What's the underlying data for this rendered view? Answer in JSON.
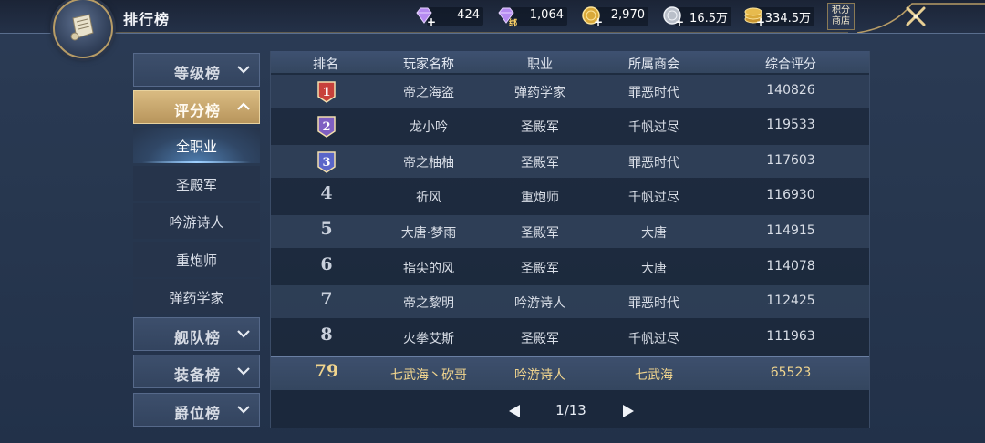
{
  "header": {
    "title": "排行榜",
    "currencies": [
      {
        "icon": "purple-diamond-icon",
        "value": "424"
      },
      {
        "icon": "bound-diamond-icon",
        "badge": "绑",
        "value": "1,064"
      },
      {
        "icon": "gold-coin-icon",
        "value": "2,970"
      },
      {
        "icon": "silver-coin-icon",
        "value": "16.5万"
      },
      {
        "icon": "gold-coin-stack-icon",
        "value": "334.5万"
      }
    ],
    "shop_label_1": "积分",
    "shop_label_2": "商店"
  },
  "sidebar": {
    "categories": [
      {
        "label": "等级榜",
        "expanded": false
      },
      {
        "label": "评分榜",
        "expanded": true
      },
      {
        "label": "舰队榜",
        "expanded": false
      },
      {
        "label": "装备榜",
        "expanded": false
      },
      {
        "label": "爵位榜",
        "expanded": false
      }
    ],
    "subitems": [
      {
        "label": "全职业",
        "active": true
      },
      {
        "label": "圣殿军",
        "active": false
      },
      {
        "label": "吟游诗人",
        "active": false
      },
      {
        "label": "重炮师",
        "active": false
      },
      {
        "label": "弹药学家",
        "active": false
      }
    ]
  },
  "table": {
    "columns": [
      "排名",
      "玩家名称",
      "职业",
      "所属商会",
      "综合评分"
    ],
    "rows": [
      {
        "rank": "1",
        "name": "帝之海盗",
        "class": "弹药学家",
        "guild": "罪恶时代",
        "score": "140826"
      },
      {
        "rank": "2",
        "name": "龙小吟",
        "class": "圣殿军",
        "guild": "千帆过尽",
        "score": "119533"
      },
      {
        "rank": "3",
        "name": "帝之柚柚",
        "class": "圣殿军",
        "guild": "罪恶时代",
        "score": "117603"
      },
      {
        "rank": "4",
        "name": "祈风",
        "class": "重炮师",
        "guild": "千帆过尽",
        "score": "116930"
      },
      {
        "rank": "5",
        "name": "大唐·梦雨",
        "class": "圣殿军",
        "guild": "大唐",
        "score": "114915"
      },
      {
        "rank": "6",
        "name": "指尖的风",
        "class": "圣殿军",
        "guild": "大唐",
        "score": "114078"
      },
      {
        "rank": "7",
        "name": "帝之黎明",
        "class": "吟游诗人",
        "guild": "罪恶时代",
        "score": "112425"
      },
      {
        "rank": "8",
        "name": "火拳艾斯",
        "class": "圣殿军",
        "guild": "千帆过尽",
        "score": "111963"
      }
    ],
    "self_row": {
      "rank": "79",
      "name": "七武海丶砍哥",
      "class": "吟游诗人",
      "guild": "七武海",
      "score": "65523"
    }
  },
  "pagination": {
    "text": "1/13"
  },
  "colors": {
    "medal_gold": "#c8413b",
    "medal_silver": "#7f5fc2",
    "medal_bronze": "#5a66c9",
    "highlight_text": "#f1d58e",
    "active_tab": "#c9a86c"
  }
}
